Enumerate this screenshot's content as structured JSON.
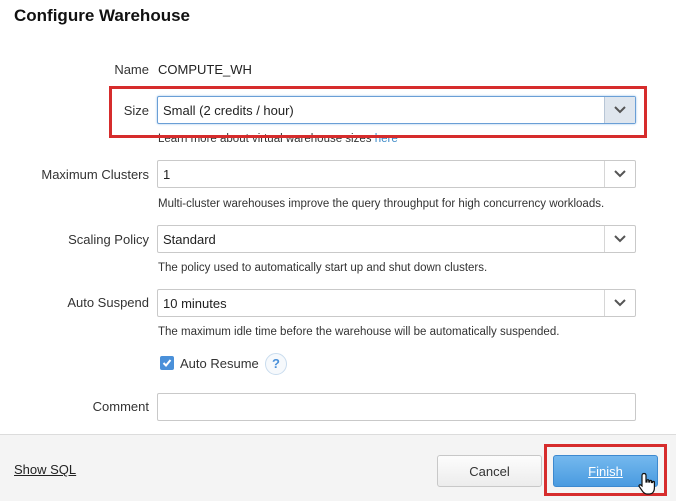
{
  "dialog": {
    "title": "Configure Warehouse"
  },
  "form": {
    "name": {
      "label": "Name",
      "value": "COMPUTE_WH"
    },
    "size": {
      "label": "Size",
      "value": "Small  (2 credits / hour)",
      "help_text": "Learn more about virtual warehouse sizes",
      "help_link": "here"
    },
    "max_clusters": {
      "label": "Maximum Clusters",
      "value": "1",
      "help_text": "Multi-cluster warehouses improve the query throughput for high concurrency workloads."
    },
    "scaling_policy": {
      "label": "Scaling Policy",
      "value": "Standard",
      "help_text": "The policy used to automatically start up and shut down clusters."
    },
    "auto_suspend": {
      "label": "Auto Suspend",
      "value": "10 minutes",
      "help_text": "The maximum idle time before the warehouse will be automatically suspended."
    },
    "auto_resume": {
      "label": "Auto Resume",
      "checked": true,
      "help_icon": "question-icon"
    },
    "comment": {
      "label": "Comment",
      "value": ""
    }
  },
  "footer": {
    "show_sql": "Show SQL",
    "cancel": "Cancel",
    "finish": "Finish"
  },
  "colors": {
    "highlight": "#d62c2c",
    "primary_button": "#4a9be0",
    "link": "#3a88c7",
    "checkbox": "#4a90d9"
  }
}
